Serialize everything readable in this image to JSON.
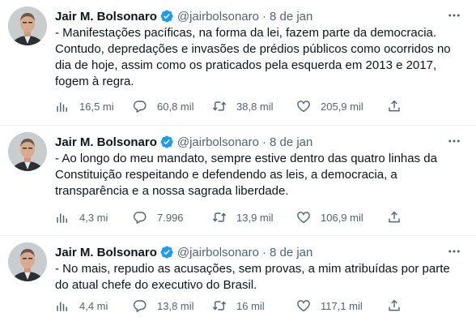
{
  "colors": {
    "text": "#0f1419",
    "muted": "#536471",
    "verified": "#1d9bf0",
    "divider": "#eff3f4"
  },
  "icons": {
    "verified": "verified-badge-icon",
    "more": "more-horizontal-icon",
    "views": "views-bar-chart-icon",
    "reply": "reply-bubble-icon",
    "retweet": "retweet-icon",
    "like": "heart-icon",
    "share": "share-upload-icon"
  },
  "tweets": [
    {
      "author": "Jair M. Bolsonaro",
      "handle": "@jairbolsonaro",
      "separator": "·",
      "date": "8 de jan",
      "text": "- Manifestações pacíficas, na forma da lei, fazem parte da democracia.\nContudo, depredações e invasões de prédios públicos como ocorridos no\ndia de hoje, assim como os praticados pela esquerda em 2013 e 2017,\nfogem à regra.",
      "views": "16,5 mi",
      "replies": "60,8 mil",
      "retweets": "38,8 mil",
      "likes": "205,9 mil"
    },
    {
      "author": "Jair M. Bolsonaro",
      "handle": "@jairbolsonaro",
      "separator": "·",
      "date": "8 de jan",
      "text": "- Ao longo do meu mandato, sempre estive dentro das quatro linhas da\nConstituição respeitando e defendendo as leis, a democracia, a\ntransparência e a nossa sagrada liberdade.",
      "views": "4,3 mi",
      "replies": "7.996",
      "retweets": "13,9 mil",
      "likes": "106,9 mil"
    },
    {
      "author": "Jair M. Bolsonaro",
      "handle": "@jairbolsonaro",
      "separator": "·",
      "date": "8 de jan",
      "text": "- No mais, repudio as acusações, sem provas, a mim atribuídas por parte\ndo atual chefe do executivo do Brasil.",
      "views": "4,4 mi",
      "replies": "13,8 mil",
      "retweets": "16 mil",
      "likes": "117,1 mil"
    }
  ]
}
